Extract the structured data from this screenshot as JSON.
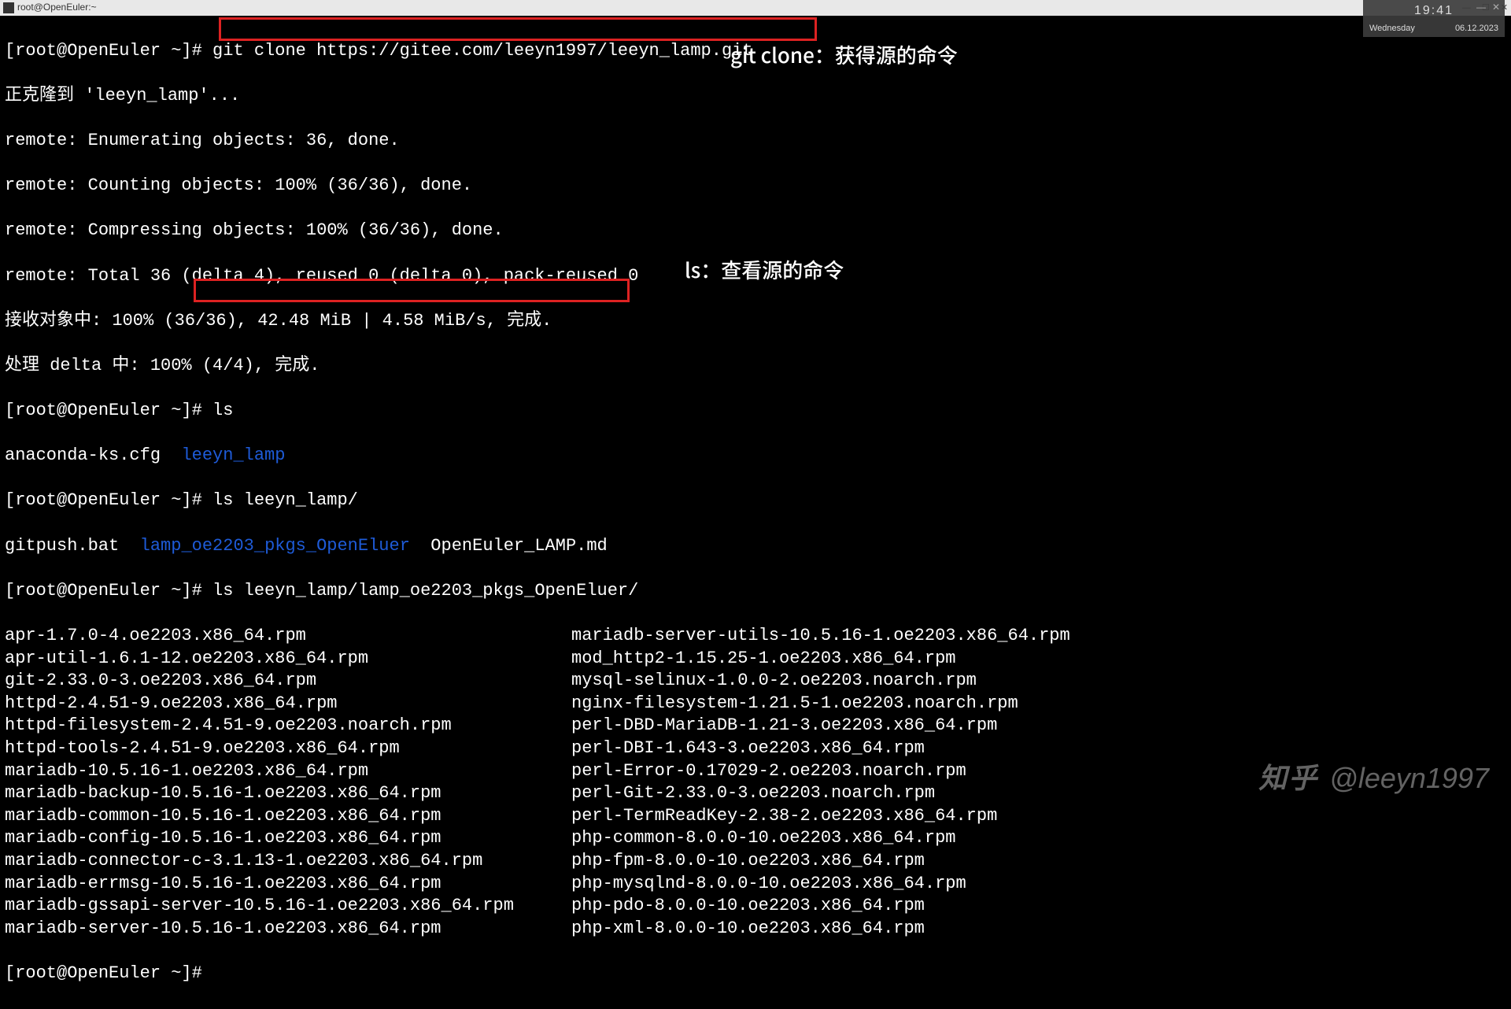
{
  "titlebar": {
    "title": "root@OpenEuler:~",
    "controls": {
      "min": "—",
      "max": "☐",
      "close": "✕"
    }
  },
  "clock": {
    "time": "19:41",
    "day": "Wednesday",
    "date": "06.12.2023",
    "min": "—",
    "close": "✕"
  },
  "annot": {
    "gitclone": "git clone：获得源的命令",
    "ls": "ls：查看源的命令"
  },
  "watermark": {
    "brand": "知乎",
    "handle": "@leeyn1997"
  },
  "prompt": "[root@OpenEuler ~]#",
  "cmd": {
    "clone": "git clone https://gitee.com/leeyn1997/leeyn_lamp.git",
    "ls": "ls",
    "ls2": "ls leeyn_lamp/",
    "ls3": "ls leeyn_lamp/lamp_oe2203_pkgs_OpenEluer/"
  },
  "out": {
    "cloning": "正克隆到 'leeyn_lamp'...",
    "enum": "remote: Enumerating objects: 36, done.",
    "count": "remote: Counting objects: 100% (36/36), done.",
    "compress": "remote: Compressing objects: 100% (36/36), done.",
    "total": "remote: Total 36 (delta 4), reused 0 (delta 0), pack-reused 0",
    "recv": "接收对象中: 100% (36/36), 42.48 MiB | 4.58 MiB/s, 完成.",
    "delta": "处理 delta 中: 100% (4/4), 完成."
  },
  "ls1": {
    "f1": "anaconda-ks.cfg  ",
    "d1": "leeyn_lamp"
  },
  "ls2": {
    "f1": "gitpush.bat  ",
    "d1": "lamp_oe2203_pkgs_OpenEluer",
    "f2": "  OpenEuler_LAMP.md"
  },
  "pkgs_left": [
    "apr-1.7.0-4.oe2203.x86_64.rpm",
    "apr-util-1.6.1-12.oe2203.x86_64.rpm",
    "git-2.33.0-3.oe2203.x86_64.rpm",
    "httpd-2.4.51-9.oe2203.x86_64.rpm",
    "httpd-filesystem-2.4.51-9.oe2203.noarch.rpm",
    "httpd-tools-2.4.51-9.oe2203.x86_64.rpm",
    "mariadb-10.5.16-1.oe2203.x86_64.rpm",
    "mariadb-backup-10.5.16-1.oe2203.x86_64.rpm",
    "mariadb-common-10.5.16-1.oe2203.x86_64.rpm",
    "mariadb-config-10.5.16-1.oe2203.x86_64.rpm",
    "mariadb-connector-c-3.1.13-1.oe2203.x86_64.rpm",
    "mariadb-errmsg-10.5.16-1.oe2203.x86_64.rpm",
    "mariadb-gssapi-server-10.5.16-1.oe2203.x86_64.rpm",
    "mariadb-server-10.5.16-1.oe2203.x86_64.rpm"
  ],
  "pkgs_right": [
    "mariadb-server-utils-10.5.16-1.oe2203.x86_64.rpm",
    "mod_http2-1.15.25-1.oe2203.x86_64.rpm",
    "mysql-selinux-1.0.0-2.oe2203.noarch.rpm",
    "nginx-filesystem-1.21.5-1.oe2203.noarch.rpm",
    "perl-DBD-MariaDB-1.21-3.oe2203.x86_64.rpm",
    "perl-DBI-1.643-3.oe2203.x86_64.rpm",
    "perl-Error-0.17029-2.oe2203.noarch.rpm",
    "perl-Git-2.33.0-3.oe2203.noarch.rpm",
    "perl-TermReadKey-2.38-2.oe2203.x86_64.rpm",
    "php-common-8.0.0-10.oe2203.x86_64.rpm",
    "php-fpm-8.0.0-10.oe2203.x86_64.rpm",
    "php-mysqlnd-8.0.0-10.oe2203.x86_64.rpm",
    "php-pdo-8.0.0-10.oe2203.x86_64.rpm",
    "php-xml-8.0.0-10.oe2203.x86_64.rpm"
  ]
}
